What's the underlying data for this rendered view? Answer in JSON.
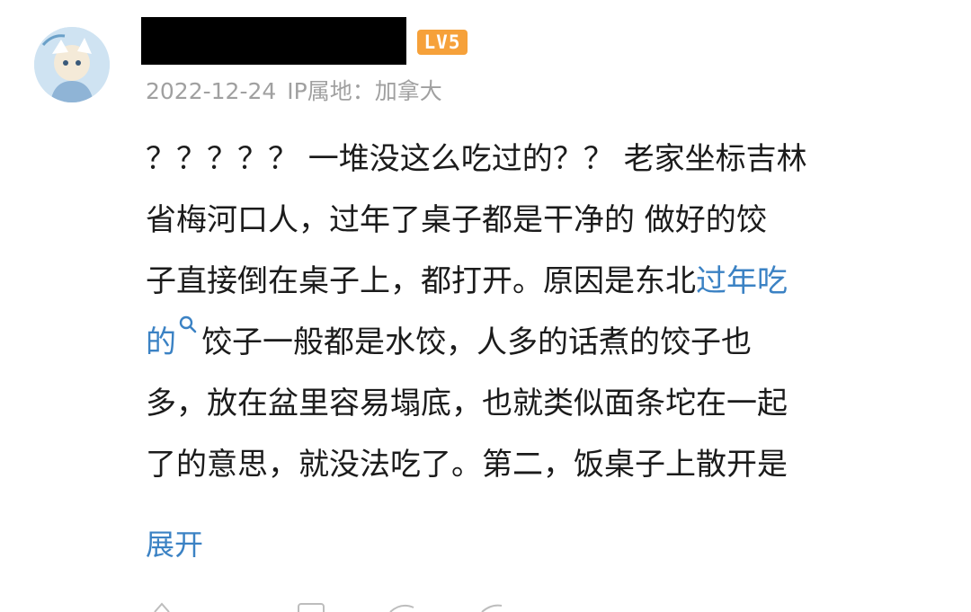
{
  "user": {
    "level_badge": "LV5",
    "date": "2022-12-24",
    "ip_location": "IP属地：加拿大"
  },
  "comment": {
    "lines": [
      "？？？？？ 一堆没这么吃过的？？ 老家坐标吉林",
      "省梅河口人，过年了桌子都是干净的 做好的饺",
      "子直接倒在桌子上，都打开。原因是东北",
      "饺子一般都是水饺，人多的话煮的饺子也",
      "多，放在盆里容易塌底，也就类似面条坨在一起",
      "了的意思，就没法吃了。第二，饭桌子上散开是"
    ],
    "link_part1": "过年吃",
    "link_part2": "的",
    "expand_label": "展开"
  },
  "colors": {
    "link": "#3b82c4",
    "badge": "#f6a13a",
    "meta": "#a0a0a0"
  },
  "icons": [
    "avatar-image",
    "search-icon",
    "like-icon",
    "dislike-icon",
    "reply-icon",
    "share-icon"
  ]
}
